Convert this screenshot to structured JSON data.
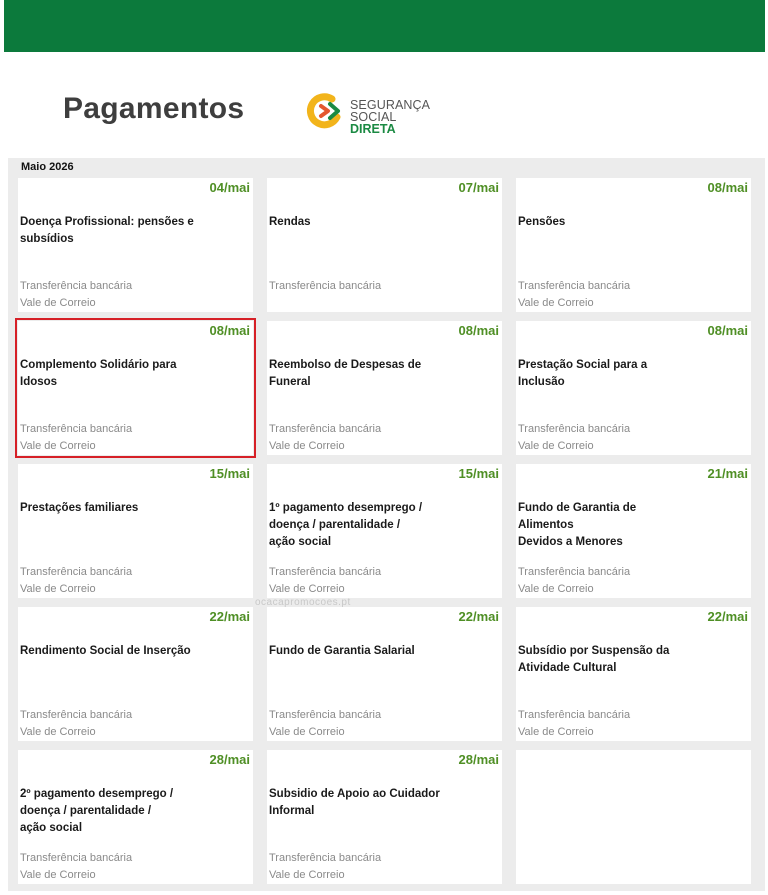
{
  "header": {
    "title": "Pagamentos",
    "logo_line1": "SEGURANÇA SOCIAL",
    "logo_line2": "DIRETA"
  },
  "calendar": {
    "month": "Maio 2026",
    "cards": [
      {
        "date": "04/mai",
        "title": "Doença Profissional: pensões e subsídios",
        "method1": "Transferência bancária",
        "method2": "Vale de Correio"
      },
      {
        "date": "07/mai",
        "title": "Rendas",
        "method1": "Transferência bancária",
        "method2": ""
      },
      {
        "date": "08/mai",
        "title": "Pensões",
        "method1": "Transferência bancária",
        "method2": "Vale de Correio"
      },
      {
        "date": "08/mai",
        "title": "Complemento Solidário para\nIdosos",
        "method1": "Transferência bancária",
        "method2": "Vale de Correio"
      },
      {
        "date": "08/mai",
        "title": "Reembolso de Despesas de\nFuneral",
        "method1": "Transferência bancária",
        "method2": "Vale de Correio"
      },
      {
        "date": "08/mai",
        "title": "Prestação Social para a Inclusão",
        "method1": "Transferência bancária",
        "method2": "Vale de Correio"
      },
      {
        "date": "15/mai",
        "title": "Prestações familiares",
        "method1": "Transferência bancária",
        "method2": "Vale de Correio"
      },
      {
        "date": "15/mai",
        "title": "1º pagamento desemprego /\ndoença / parentalidade /\nação social",
        "method1": "Transferência bancária",
        "method2": "Vale de Correio"
      },
      {
        "date": "21/mai",
        "title": "Fundo de Garantia de Alimentos\n Devidos a Menores",
        "method1": "Transferência bancária",
        "method2": "Vale de Correio"
      },
      {
        "date": "22/mai",
        "title": "Rendimento Social de Inserção",
        "method1": "Transferência bancária",
        "method2": "Vale de Correio"
      },
      {
        "date": "22/mai",
        "title": "Fundo de Garantia Salarial",
        "method1": "Transferência bancária",
        "method2": "Vale de Correio"
      },
      {
        "date": "22/mai",
        "title": "Subsídio por Suspensão da\nAtividade Cultural",
        "method1": "Transferência bancária",
        "method2": "Vale de Correio"
      },
      {
        "date": "28/mai",
        "title": "2º pagamento desemprego /\ndoença / parentalidade /\nação social",
        "method1": "Transferência bancária",
        "method2": "Vale de Correio"
      },
      {
        "date": "28/mai",
        "title": "Subsidio de Apoio ao Cuidador\n Informal",
        "method1": "Transferência bancária",
        "method2": "Vale de Correio"
      },
      {
        "date": "",
        "title": "",
        "method1": "",
        "method2": ""
      }
    ]
  },
  "watermark": "ocacapromocoes.pt",
  "colors": {
    "brand_green": "#0c7a3c",
    "date_green": "#4f8f25",
    "highlight_red": "#d62027"
  }
}
